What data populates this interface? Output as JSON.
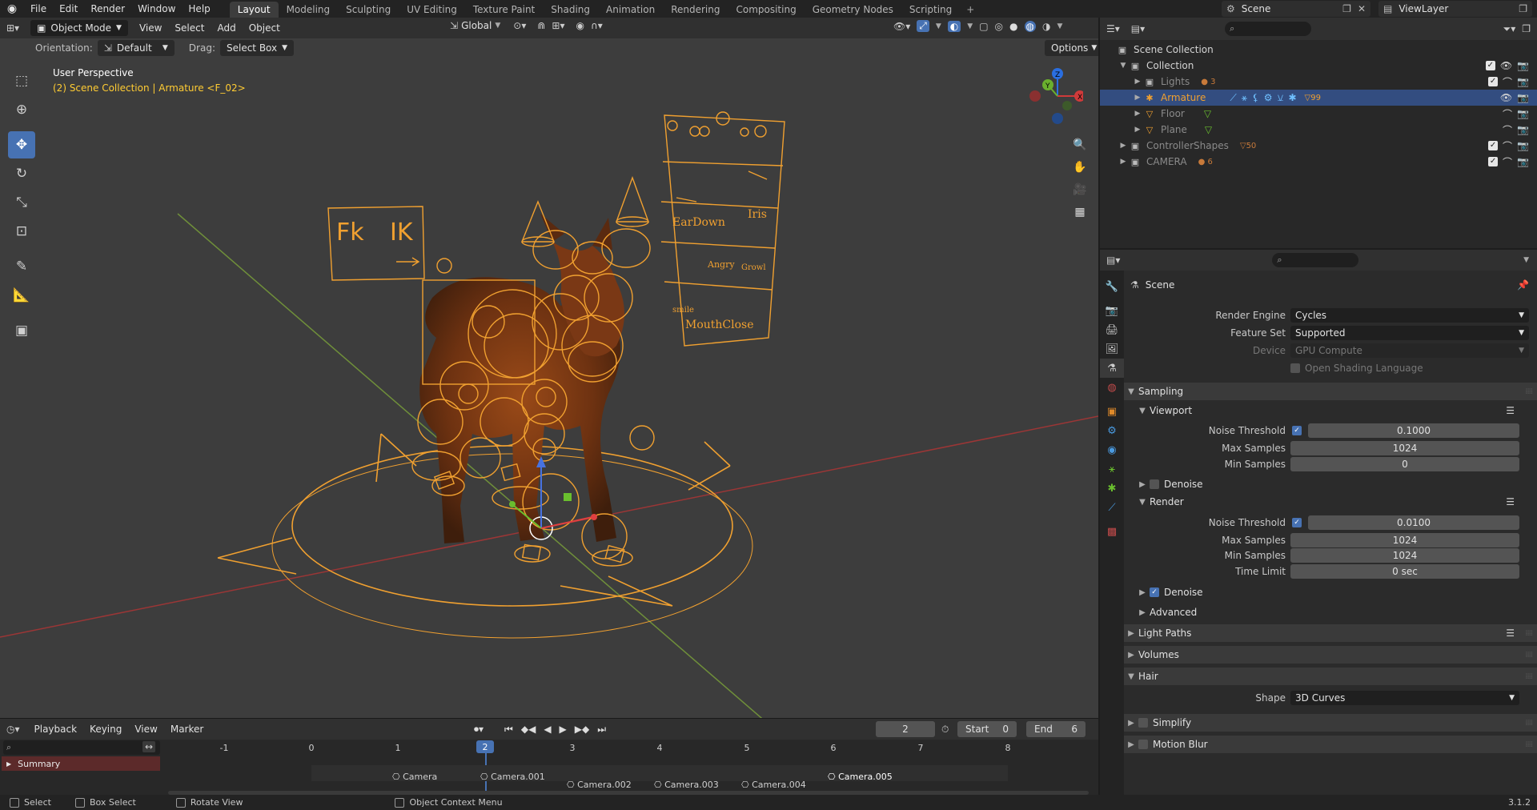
{
  "topbar": {
    "menus": [
      "File",
      "Edit",
      "Render",
      "Window",
      "Help"
    ],
    "workspaces": [
      "Layout",
      "Modeling",
      "Sculpting",
      "UV Editing",
      "Texture Paint",
      "Shading",
      "Animation",
      "Rendering",
      "Compositing",
      "Geometry Nodes",
      "Scripting"
    ],
    "active_workspace": "Layout",
    "scene_name": "Scene",
    "view_layer": "ViewLayer"
  },
  "viewport": {
    "mode": "Object Mode",
    "menus": [
      "View",
      "Select",
      "Add",
      "Object"
    ],
    "transform_space": "Global",
    "orientation_label": "Orientation:",
    "orientation_value": "Default",
    "drag_label": "Drag:",
    "drag_value": "Select Box",
    "options_label": "Options",
    "view_name": "User Perspective",
    "object_info": "(2) Scene Collection | Armature <F_02>",
    "panel_labels": {
      "fk": "Fk",
      "ik": "IK",
      "eardown": "EarDown",
      "iris": "Iris",
      "angry": "Angry",
      "growl": "Growl",
      "smile": "smile",
      "mouthclose": "MouthClose"
    },
    "gizmo_axes": {
      "x": "X",
      "y": "Y",
      "z": "Z"
    },
    "colors": {
      "wire": "#f0a030",
      "x_axis": "#b33a3a",
      "y_axis": "#6b9a2e",
      "active_blue": "#4772b3"
    }
  },
  "timeline": {
    "menus": [
      "Playback",
      "Keying",
      "View",
      "Marker"
    ],
    "current_frame": "2",
    "start_label": "Start",
    "start_value": "0",
    "end_label": "End",
    "end_value": "6",
    "frame_numbers": [
      "-1",
      "0",
      "1",
      "2",
      "3",
      "4",
      "5",
      "6",
      "7",
      "8"
    ],
    "summary_label": "Summary",
    "markers": [
      "Camera",
      "Camera.001",
      "Camera.002",
      "Camera.003",
      "Camera.004",
      "Camera.005"
    ]
  },
  "statusbar": {
    "select": "Select",
    "box_select": "Box Select",
    "rotate_view": "Rotate View",
    "context_menu": "Object Context Menu",
    "version": "3.1.2"
  },
  "outliner": {
    "root": "Scene Collection",
    "items": [
      {
        "name": "Collection",
        "badge": ""
      },
      {
        "name": "Lights",
        "badge": "3"
      },
      {
        "name": "Armature",
        "badge": "99"
      },
      {
        "name": "Floor",
        "badge": ""
      },
      {
        "name": "Plane",
        "badge": ""
      },
      {
        "name": "ControllerShapes",
        "badge": "50"
      },
      {
        "name": "CAMERA",
        "badge": "6"
      }
    ]
  },
  "properties": {
    "context": "Scene",
    "render_engine_label": "Render Engine",
    "render_engine": "Cycles",
    "feature_set_label": "Feature Set",
    "feature_set": "Supported",
    "device_label": "Device",
    "device": "GPU Compute",
    "osl_label": "Open Shading Language",
    "sampling": "Sampling",
    "viewport": "Viewport",
    "noise_threshold_label": "Noise Threshold",
    "vp_noise_threshold": "0.1000",
    "max_samples_label": "Max Samples",
    "vp_max_samples": "1024",
    "min_samples_label": "Min Samples",
    "vp_min_samples": "0",
    "denoise_label": "Denoise",
    "render": "Render",
    "r_noise_threshold": "0.0100",
    "r_max_samples": "1024",
    "r_min_samples": "1024",
    "time_limit_label": "Time Limit",
    "r_time_limit": "0 sec",
    "advanced": "Advanced",
    "light_paths": "Light Paths",
    "volumes": "Volumes",
    "hair": "Hair",
    "shape_label": "Shape",
    "shape_value": "3D Curves",
    "simplify": "Simplify",
    "motion_blur": "Motion Blur"
  }
}
